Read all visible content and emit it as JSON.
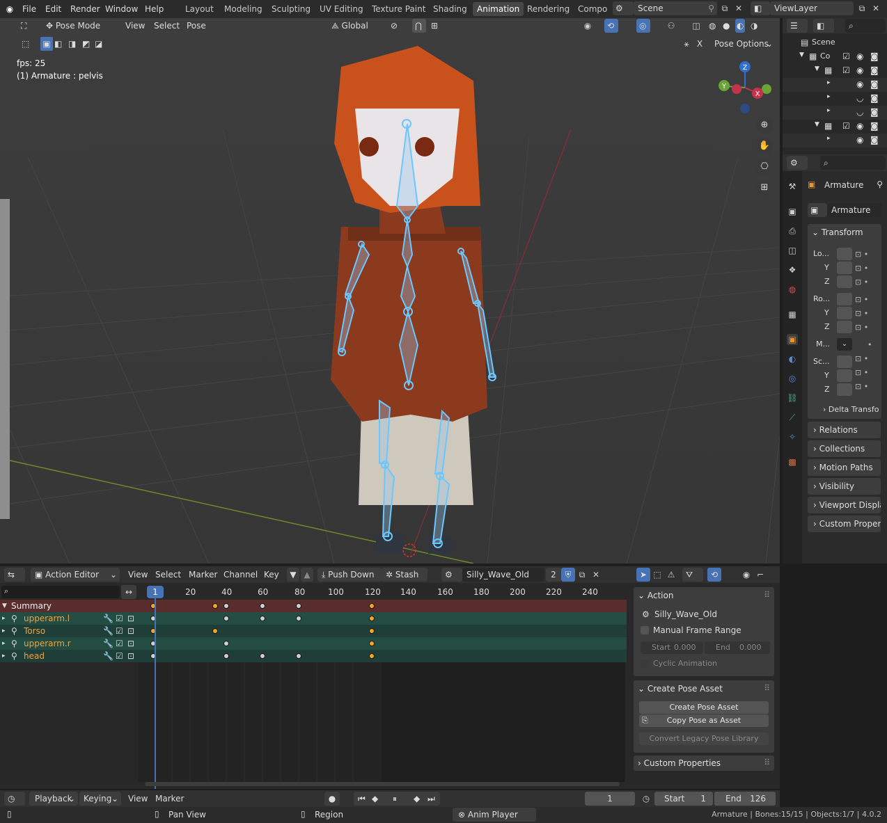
{
  "topbar": {
    "menus": [
      "File",
      "Edit",
      "Render",
      "Window",
      "Help"
    ],
    "workspaces": [
      "Layout",
      "Modeling",
      "Sculpting",
      "UV Editing",
      "Texture Paint",
      "Shading",
      "Animation",
      "Rendering",
      "Compo"
    ],
    "active_workspace": "Animation",
    "scene": "Scene",
    "view_layer": "ViewLayer"
  },
  "viewport": {
    "mode": "Pose Mode",
    "menus": [
      "View",
      "Select",
      "Pose"
    ],
    "orientation": "Global",
    "pose_options": "Pose Options",
    "overlay_fps": "fps: 25",
    "overlay_object": "(1) Armature : pelvis",
    "x_label": "X",
    "gizmo_axes": {
      "z": "Z",
      "y": "Y",
      "x": "X"
    }
  },
  "outliner": {
    "scene_label": "Scene",
    "collection_label": "Co"
  },
  "properties": {
    "object_name": "Armature",
    "data_name": "Armature",
    "transform_title": "Transform",
    "location_label": "Lo...",
    "rotation_label": "Ro...",
    "mode_label": "M...",
    "scale_label": "Sc...",
    "axis_y": "Y",
    "axis_z": "Z",
    "delta": "Delta Transfo",
    "panels": [
      "Relations",
      "Collections",
      "Motion Paths",
      "Visibility",
      "Viewport Displa",
      "Custom Properti"
    ]
  },
  "action_editor": {
    "editor_mode": "Action Editor",
    "menus": [
      "View",
      "Select",
      "Marker",
      "Channel",
      "Key"
    ],
    "push_down": "Push Down",
    "stash": "Stash",
    "action_name": "Silly_Wave_Old",
    "users": "2",
    "current_frame_marker": "1",
    "ruler": [
      "20",
      "40",
      "60",
      "80",
      "100",
      "120",
      "140",
      "160",
      "180",
      "200",
      "220",
      "240"
    ],
    "channels": [
      "Summary",
      "upperarm.l",
      "Torso",
      "upperarm.r",
      "head"
    ]
  },
  "action_panel": {
    "title": "Action",
    "action_name": "Silly_Wave_Old",
    "manual_frame_range": "Manual Frame Range",
    "start_label": "Start",
    "start_value": "0.000",
    "end_label": "End",
    "end_value": "0.000",
    "cyclic": "Cyclic Animation",
    "pose_asset_title": "Create Pose Asset",
    "create_pose_asset": "Create Pose Asset",
    "copy_pose_as_asset": "Copy Pose as Asset",
    "convert_legacy": "Convert Legacy Pose Library",
    "custom_properties": "Custom Properties"
  },
  "timeline": {
    "playback": "Playback",
    "keying": "Keying",
    "menus": [
      "View",
      "Marker"
    ],
    "current_frame": "1",
    "start_label": "Start",
    "start_value": "1",
    "end_label": "End",
    "end_value": "126"
  },
  "statusbar": {
    "pan_view": "Pan View",
    "region": "Region",
    "anim_player": "Anim Player",
    "stats": "Armature | Bones:15/15 | Objects:1/7 | 4.0.2"
  }
}
